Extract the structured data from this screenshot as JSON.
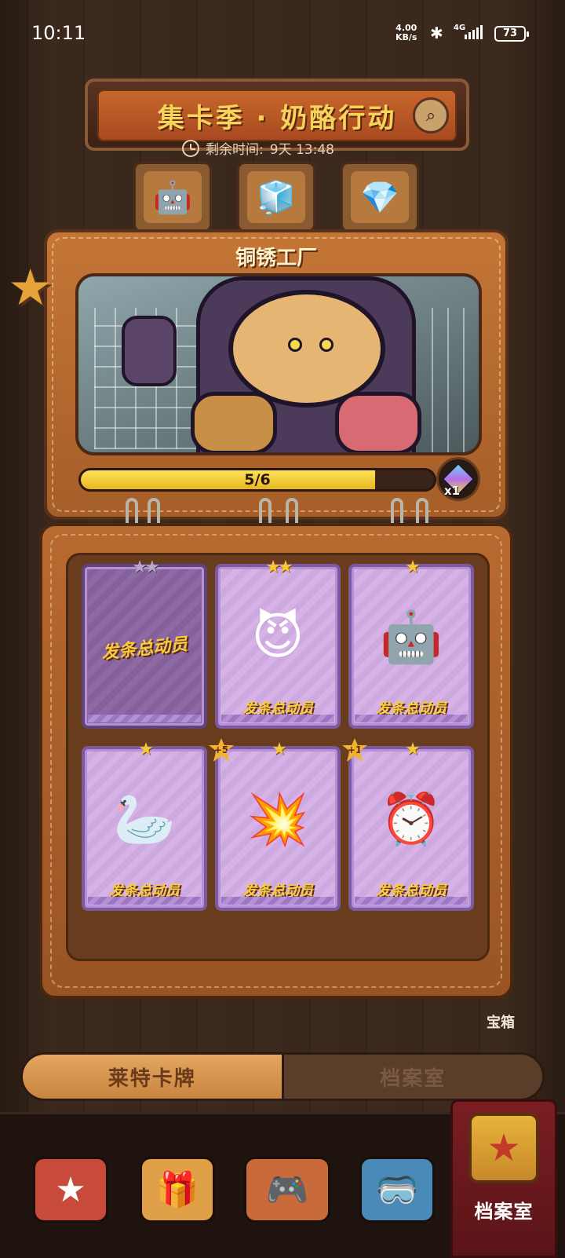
{
  "status_bar": {
    "time": "10:11",
    "net_speed_value": "4.00",
    "net_speed_unit": "KB/s",
    "network": "4G",
    "battery": "73"
  },
  "header": {
    "title": "集卡季 · 奶酪行动",
    "timer_label": "剩余时间:",
    "timer_value": "9天 13:48"
  },
  "factory": {
    "name": "铜锈工厂",
    "progress_text": "5/6",
    "progress_fraction": 0.833,
    "reward_count": "x1"
  },
  "cards": [
    {
      "tag": "发条总动员",
      "stars": "★★",
      "collected": false,
      "art": "gear",
      "plus": ""
    },
    {
      "tag": "发条总动员",
      "stars": "★★",
      "collected": true,
      "art": "devil-machine",
      "plus": ""
    },
    {
      "tag": "发条总动员",
      "stars": "★",
      "collected": true,
      "art": "blue-robot",
      "plus": ""
    },
    {
      "tag": "发条总动员",
      "stars": "★",
      "collected": true,
      "art": "bird",
      "plus": ""
    },
    {
      "tag": "发条总动员",
      "stars": "★",
      "collected": true,
      "art": "cannon",
      "plus": "+5"
    },
    {
      "tag": "发条总动员",
      "stars": "★",
      "collected": true,
      "art": "alarm-clock-bomb",
      "plus": "+1"
    }
  ],
  "side": {
    "chest_label": "宝箱"
  },
  "tabs": {
    "cards": "莱特卡牌",
    "archive": "档案室"
  },
  "bottom_nav": {
    "active_label": "档案室"
  }
}
